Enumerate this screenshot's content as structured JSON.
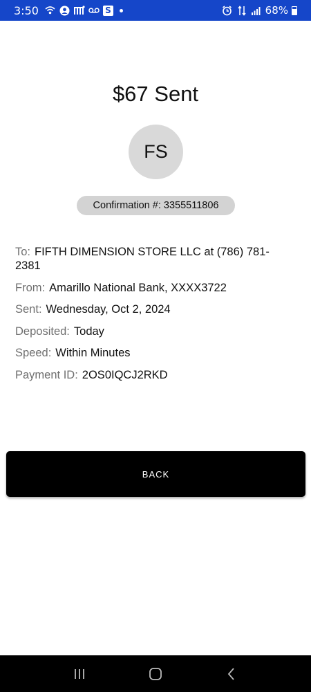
{
  "status_bar": {
    "time": "3:50",
    "battery_pct": "68%",
    "battery_level": 0.68,
    "icons_left": [
      "wifi-calling-icon",
      "account-icon",
      "m-app-icon",
      "voicemail-icon",
      "s-app-icon",
      "notification-dot-icon"
    ],
    "icons_right": [
      "alarm-icon",
      "data-transfer-icon",
      "signal-icon",
      "battery-icon"
    ],
    "color": "#1546c9"
  },
  "payment": {
    "title": "$67 Sent",
    "avatar_initials": "FS",
    "confirmation": "Confirmation #: 3355511806",
    "details": [
      {
        "label": "To:",
        "value": "FIFTH DIMENSION STORE LLC at (786) 781-2381"
      },
      {
        "label": "From:",
        "value": "Amarillo National Bank, XXXX3722"
      },
      {
        "label": "Sent:",
        "value": "Wednesday, Oct 2, 2024"
      },
      {
        "label": "Deposited:",
        "value": "Today"
      },
      {
        "label": "Speed:",
        "value": "Within Minutes"
      },
      {
        "label": "Payment ID:",
        "value": "2OS0IQCJ2RKD"
      }
    ]
  },
  "actions": {
    "back_label": "BACK"
  },
  "nav_bar": {
    "buttons": [
      "recent-apps-icon",
      "home-icon",
      "back-icon"
    ]
  }
}
